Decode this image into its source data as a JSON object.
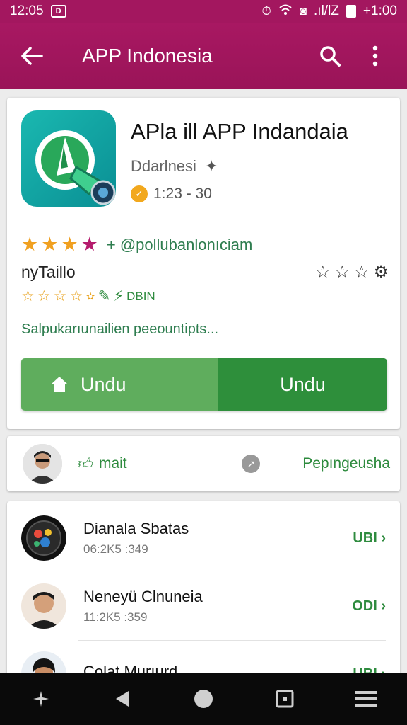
{
  "status_bar": {
    "time": "12:05",
    "notif_badge": "D",
    "right_text": "+1:00",
    "signal_text": ".ıl/lZ"
  },
  "app_bar": {
    "title": "APP Indonesia"
  },
  "app": {
    "name": "APla ill APP Indandaia",
    "developer": "Ddarlnesi",
    "version": "1:23 - 30",
    "rating_handle": "+ @polluban⁠lonıciam",
    "install_label": "nyTaillo",
    "small_rating_text": "DBIN",
    "description": "Salpukarıunailien peeountipts...",
    "btn_left": "Undu",
    "btn_right": "Undu"
  },
  "author_row": {
    "mail_label": "mait",
    "link_label": "Pepıngeusha"
  },
  "list": [
    {
      "title": "Dianala Sbatas",
      "subtitle": "06:2K5 :349",
      "action": "UBI ›"
    },
    {
      "title": "Neneyü Clnuneia",
      "subtitle": "11:2K5 :359",
      "action": "ODI ›"
    },
    {
      "title": "Colat Murıurd",
      "subtitle": "",
      "action": "UBI ›"
    }
  ],
  "colors": {
    "app_bar": "#a3175f",
    "accent_green": "#2e8b3e",
    "button_left": "#5fad5d",
    "button_right": "#2e8f3b"
  },
  "icons": [
    "back-arrow-icon",
    "search-icon",
    "more-vert-icon",
    "home-icon",
    "star-icon",
    "nav-back-icon",
    "nav-home-icon",
    "nav-recents-icon",
    "nav-menu-icon"
  ]
}
